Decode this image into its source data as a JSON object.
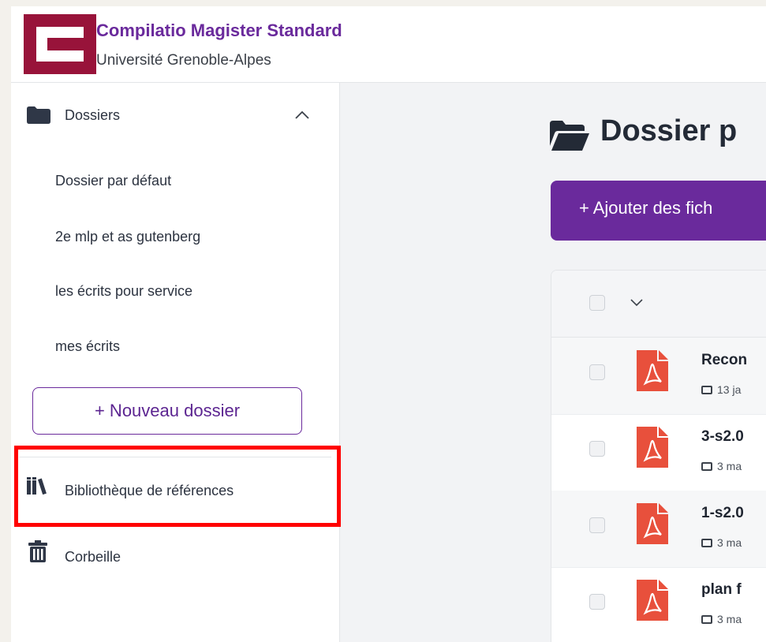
{
  "header": {
    "app_title": "Compilatio Magister Standard",
    "institution": "Université Grenoble-Alpes",
    "brand_color": "#98133a",
    "accent_color": "#6a2a9c"
  },
  "sidebar": {
    "folders_label": "Dossiers",
    "folders_expanded": true,
    "folders": [
      {
        "label": "Dossier par défaut"
      },
      {
        "label": "2e mlp et as gutenberg"
      },
      {
        "label": "les écrits pour service"
      },
      {
        "label": "mes écrits"
      }
    ],
    "new_folder_label": "+ Nouveau dossier",
    "library_label": "Bibliothèque de références",
    "library_highlighted": true,
    "highlight_color": "#ff0000",
    "trash_label": "Corbeille"
  },
  "main": {
    "title": "Dossier p",
    "add_files_label": "+ Ajouter des fich",
    "documents": [
      {
        "name": "Recon",
        "meta": "13 ja",
        "icon": "pdf-icon"
      },
      {
        "name": "3-s2.0",
        "meta": "3 ma",
        "icon": "pdf-icon"
      },
      {
        "name": "1-s2.0",
        "meta": "3 ma",
        "icon": "pdf-icon"
      },
      {
        "name": "plan f",
        "meta": "3 ma",
        "icon": "pdf-icon"
      }
    ]
  }
}
